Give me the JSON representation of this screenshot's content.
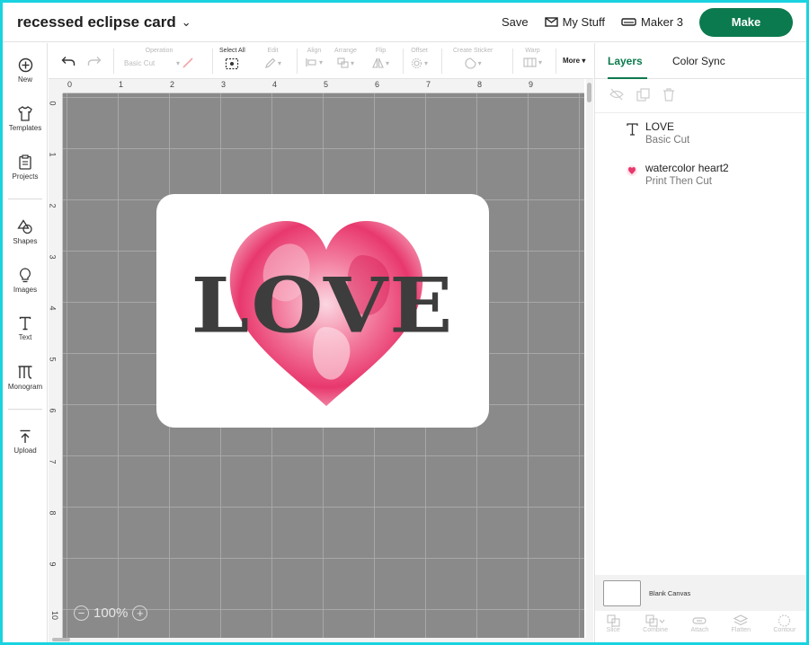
{
  "header": {
    "project_title": "recessed eclipse card",
    "save_label": "Save",
    "my_stuff_label": "My Stuff",
    "machine_label": "Maker 3",
    "make_label": "Make"
  },
  "sidebar": {
    "items": [
      {
        "label": "New",
        "icon": "plus-circle-icon"
      },
      {
        "label": "Templates",
        "icon": "shirt-icon"
      },
      {
        "label": "Projects",
        "icon": "clipboard-icon"
      },
      {
        "label": "Shapes",
        "icon": "shapes-icon"
      },
      {
        "label": "Images",
        "icon": "lightbulb-icon"
      },
      {
        "label": "Text",
        "icon": "text-icon"
      },
      {
        "label": "Monogram",
        "icon": "monogram-icon"
      },
      {
        "label": "Upload",
        "icon": "upload-icon"
      }
    ]
  },
  "toolbar": {
    "operation_label": "Operation",
    "operation_value": "Basic Cut",
    "select_all_label": "Select All",
    "edit_label": "Edit",
    "align_label": "Align",
    "arrange_label": "Arrange",
    "flip_label": "Flip",
    "offset_label": "Offset",
    "create_sticker_label": "Create Sticker",
    "warp_label": "Warp",
    "more_label": "More"
  },
  "rulers": {
    "top": [
      "0",
      "1",
      "2",
      "3",
      "4",
      "5",
      "6",
      "7",
      "8",
      "9"
    ],
    "left": [
      "0",
      "1",
      "2",
      "3",
      "4",
      "5",
      "6",
      "7",
      "8",
      "9",
      "10"
    ]
  },
  "canvas": {
    "card_text": "LOVE",
    "zoom_level": "100%",
    "colors": {
      "grid": "#8a8a8a",
      "card": "#ffffff",
      "text": "#3d3d3d",
      "heart": "#e8386d"
    }
  },
  "panel": {
    "tabs": [
      "Layers",
      "Color Sync"
    ],
    "layers": [
      {
        "name": "LOVE",
        "operation": "Basic Cut",
        "icon": "text-icon"
      },
      {
        "name": "watercolor heart2",
        "operation": "Print Then Cut",
        "icon": "heart-thumbnail-icon"
      }
    ],
    "canvas_label": "Blank Canvas",
    "bottom_tools": [
      "Slice",
      "Combine",
      "Attach",
      "Flatten",
      "Contour"
    ]
  },
  "accent_color": "#0b7a4e"
}
